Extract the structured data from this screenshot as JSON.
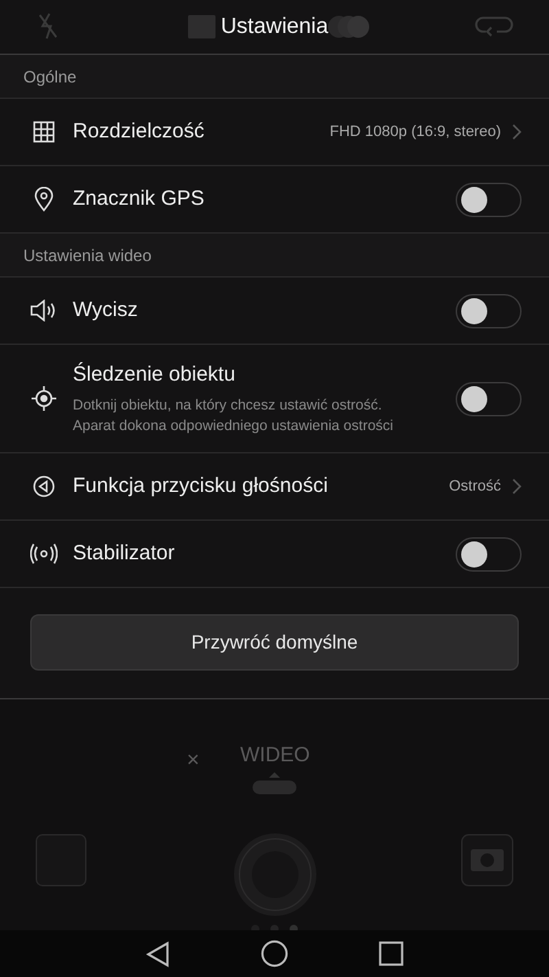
{
  "top_bar": {
    "title": "Ustawienia"
  },
  "sections": [
    {
      "title": "Ogólne",
      "items": [
        {
          "kind": "value",
          "label": "Rozdzielczość",
          "value": "FHD 1080p (16:9, stereo)"
        },
        {
          "kind": "toggle",
          "label": "Znacznik GPS",
          "on": false
        }
      ]
    },
    {
      "title": "Ustawienia wideo",
      "items": [
        {
          "kind": "toggle",
          "label": "Wycisz",
          "on": false
        },
        {
          "kind": "toggle",
          "label": "Śledzenie obiektu",
          "description": "Dotknij obiektu, na który chcesz ustawić ostrość. Aparat dokona odpowiedniego ustawienia ostrości",
          "on": false
        },
        {
          "kind": "value",
          "label": "Funkcja przycisku głośności",
          "value": "Ostrość"
        },
        {
          "kind": "toggle",
          "label": "Stabilizator",
          "on": false
        }
      ]
    }
  ],
  "reset_button": "Przywróć domyślne",
  "camera": {
    "close": "×",
    "mode": "WIDEO"
  }
}
